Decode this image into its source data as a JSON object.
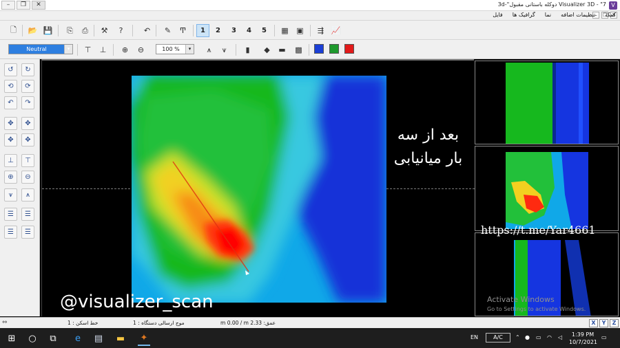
{
  "window": {
    "title": "Visualizer 3D - \"7 دوکله باستانی مقبول\"-3d",
    "buttons": [
      "–",
      "❐",
      "✕"
    ]
  },
  "menu": {
    "items": [
      "فایل",
      "گرافیک ها",
      "نما",
      "تنظیمات اضافه",
      "کمک"
    ]
  },
  "toolbar": {
    "view_numbers": [
      "1",
      "2",
      "3",
      "4",
      "5"
    ],
    "selected_view": "1",
    "palette": "Neutral",
    "zoom": "100 %"
  },
  "colors": {
    "swatch_blue": "#1b3fd6",
    "swatch_green": "#1f9a2e",
    "swatch_red": "#e21a1a"
  },
  "main_view": {
    "overlay_text_line1": "بعد از سه",
    "overlay_text_line2": "بار میانیابی",
    "watermark": "@visualizer_scan"
  },
  "side_panels": {
    "telegram_url": "https://t.me/Yar4661",
    "activate_title": "Activate Windows",
    "activate_sub": "Go to Settings to activate Windows."
  },
  "status": {
    "line_scale": "خط اسکن : 1",
    "device_mode": "موج ارسالی دستگاه : 1",
    "depth": "عمق: m 0.00 / m 2.33",
    "axes": [
      "X",
      "Y",
      "Z"
    ]
  },
  "taskbar": {
    "lang": "EN",
    "ac": "A/C",
    "time": "1:39 PM",
    "date": "10/7/2021"
  }
}
